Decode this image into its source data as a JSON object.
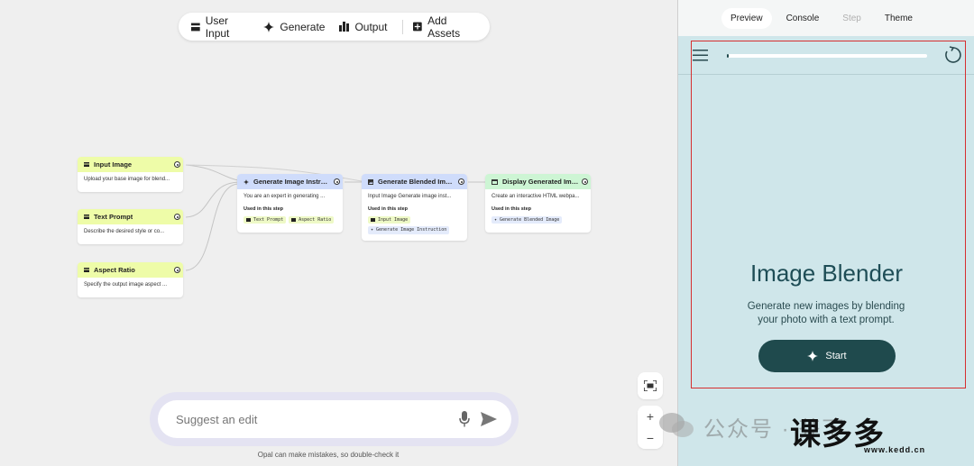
{
  "toolbar": {
    "user_input": "User Input",
    "generate": "Generate",
    "output": "Output",
    "add_assets": "Add Assets"
  },
  "nodes": {
    "input_image": {
      "title": "Input Image",
      "desc": "Upload your base image for blend..."
    },
    "text_prompt": {
      "title": "Text Prompt",
      "desc": "Describe the desired style or co..."
    },
    "aspect_ratio": {
      "title": "Aspect Ratio",
      "desc": "Specify the output image aspect ..."
    },
    "gen_instruction": {
      "title": "Generate Image Instruction",
      "desc": "You are an expert in generating ...",
      "used": "Used in this step",
      "chips": [
        "Text Prompt",
        "Aspect Ratio"
      ]
    },
    "gen_blended": {
      "title": "Generate Blended Image",
      "desc": "Input Image Generate image inst...",
      "used": "Used in this step",
      "chips": [
        "Input Image",
        "Generate Image Instruction"
      ]
    },
    "display": {
      "title": "Display Generated Image in ...",
      "desc": "Create an interactive HTML webpa...",
      "used": "Used in this step",
      "chips": [
        "Generate Blended Image"
      ]
    }
  },
  "suggest": {
    "placeholder": "Suggest an edit"
  },
  "disclaimer": "Opal can make mistakes, so double-check it",
  "zoom": {
    "plus": "+",
    "minus": "−"
  },
  "panel": {
    "tabs": [
      "Preview",
      "Console",
      "Step",
      "Theme"
    ],
    "active_tab": "Preview",
    "progress_fraction": 0.01,
    "app_title": "Image Blender",
    "app_subtitle": "Generate new images by blending your photo with a text prompt.",
    "start_label": "Start"
  },
  "watermark": {
    "text": "公众号 · 芥下",
    "logo": "课多多",
    "url": "www.kedd.cn"
  },
  "colors": {
    "start_button": "#1f4a4d",
    "panel_bg": "#cfe6ea",
    "highlight_box": "#d62f2f",
    "input_node": "#eefca8",
    "generate_node": "#cfdcfb",
    "output_node": "#cdf5d4"
  }
}
